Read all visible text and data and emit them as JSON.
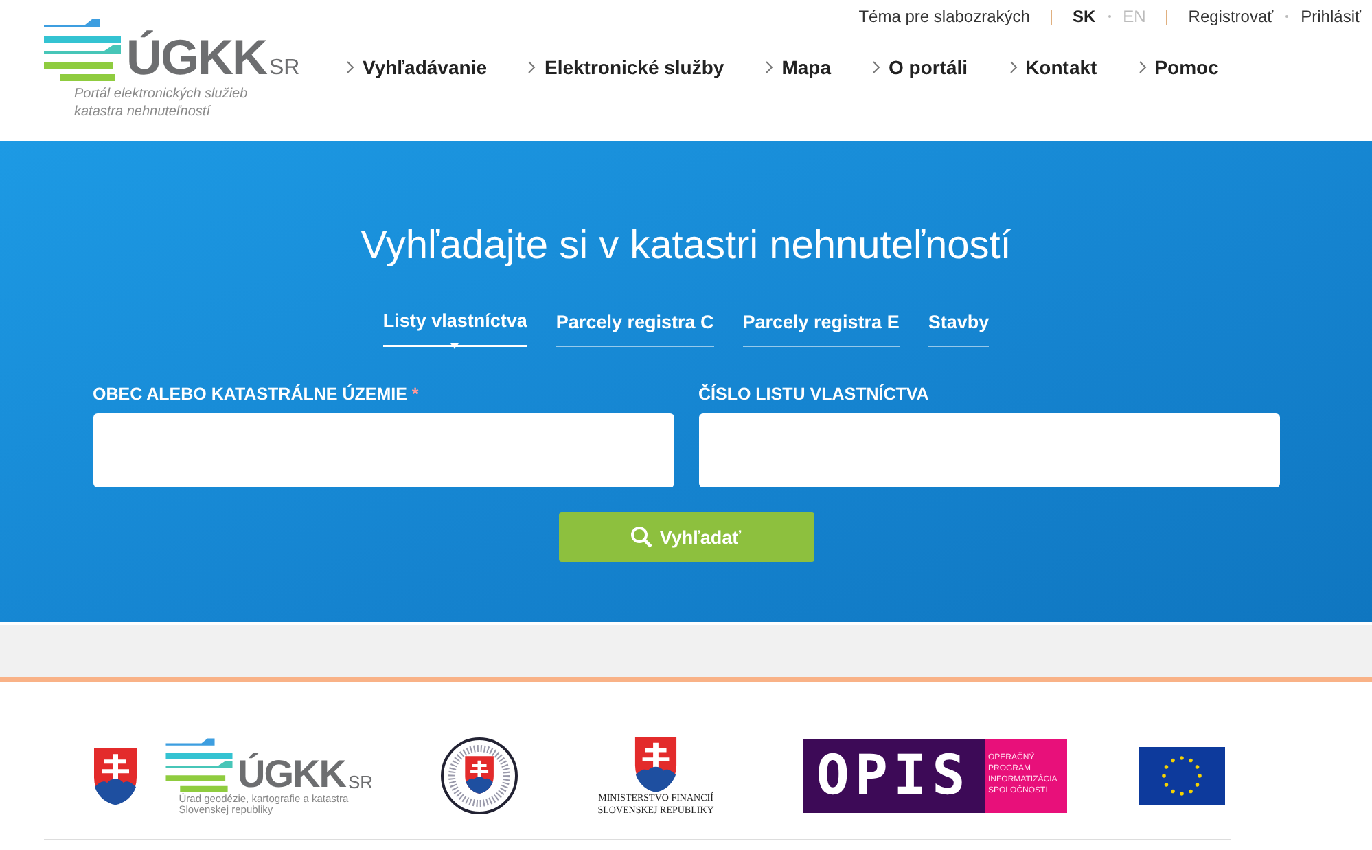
{
  "logo": {
    "mark": "ÚGKK",
    "suffix": "SR",
    "tagline": "Portál elektronických služieb katastra nehnuteľností"
  },
  "utility": {
    "accessibility": "Téma pre slabozrakých",
    "languages": [
      {
        "label": "SK",
        "selected": true
      },
      {
        "label": "EN",
        "selected": false
      }
    ],
    "register": "Registrovať",
    "login": "Prihlásiť"
  },
  "nav": [
    "Vyhľadávanie",
    "Elektronické služby",
    "Mapa",
    "O portáli",
    "Kontakt",
    "Pomoc"
  ],
  "hero": {
    "title": "Vyhľadajte si v katastri nehnuteľností",
    "tabs": [
      {
        "label": "Listy vlastníctva",
        "selected": true
      },
      {
        "label": "Parcely registra C",
        "selected": false
      },
      {
        "label": "Parcely registra E",
        "selected": false
      },
      {
        "label": "Stavby",
        "selected": false
      }
    ],
    "fields": [
      {
        "label": "OBEC ALEBO KATASTRÁLNE ÚZEMIE",
        "required": true
      },
      {
        "label": "ČÍSLO LISTU VLASTNÍCTVA",
        "required": false
      }
    ],
    "required_mark": "*",
    "button": "Vyhľadať"
  },
  "footer": {
    "ugkk": {
      "mark": "ÚGKK",
      "suffix": "SR",
      "caption": "Úrad geodézie, kartografie a katastra Slovenskej republiky"
    },
    "ministry": "MINISTERSTVO FINANCIÍ SLOVENSKEJ REPUBLIKY",
    "opis": {
      "mark": "OPIS",
      "caption": "OPERAČNÝ PROGRAM INFORMATIZÁCIA SPOLOČNOSTI"
    }
  }
}
